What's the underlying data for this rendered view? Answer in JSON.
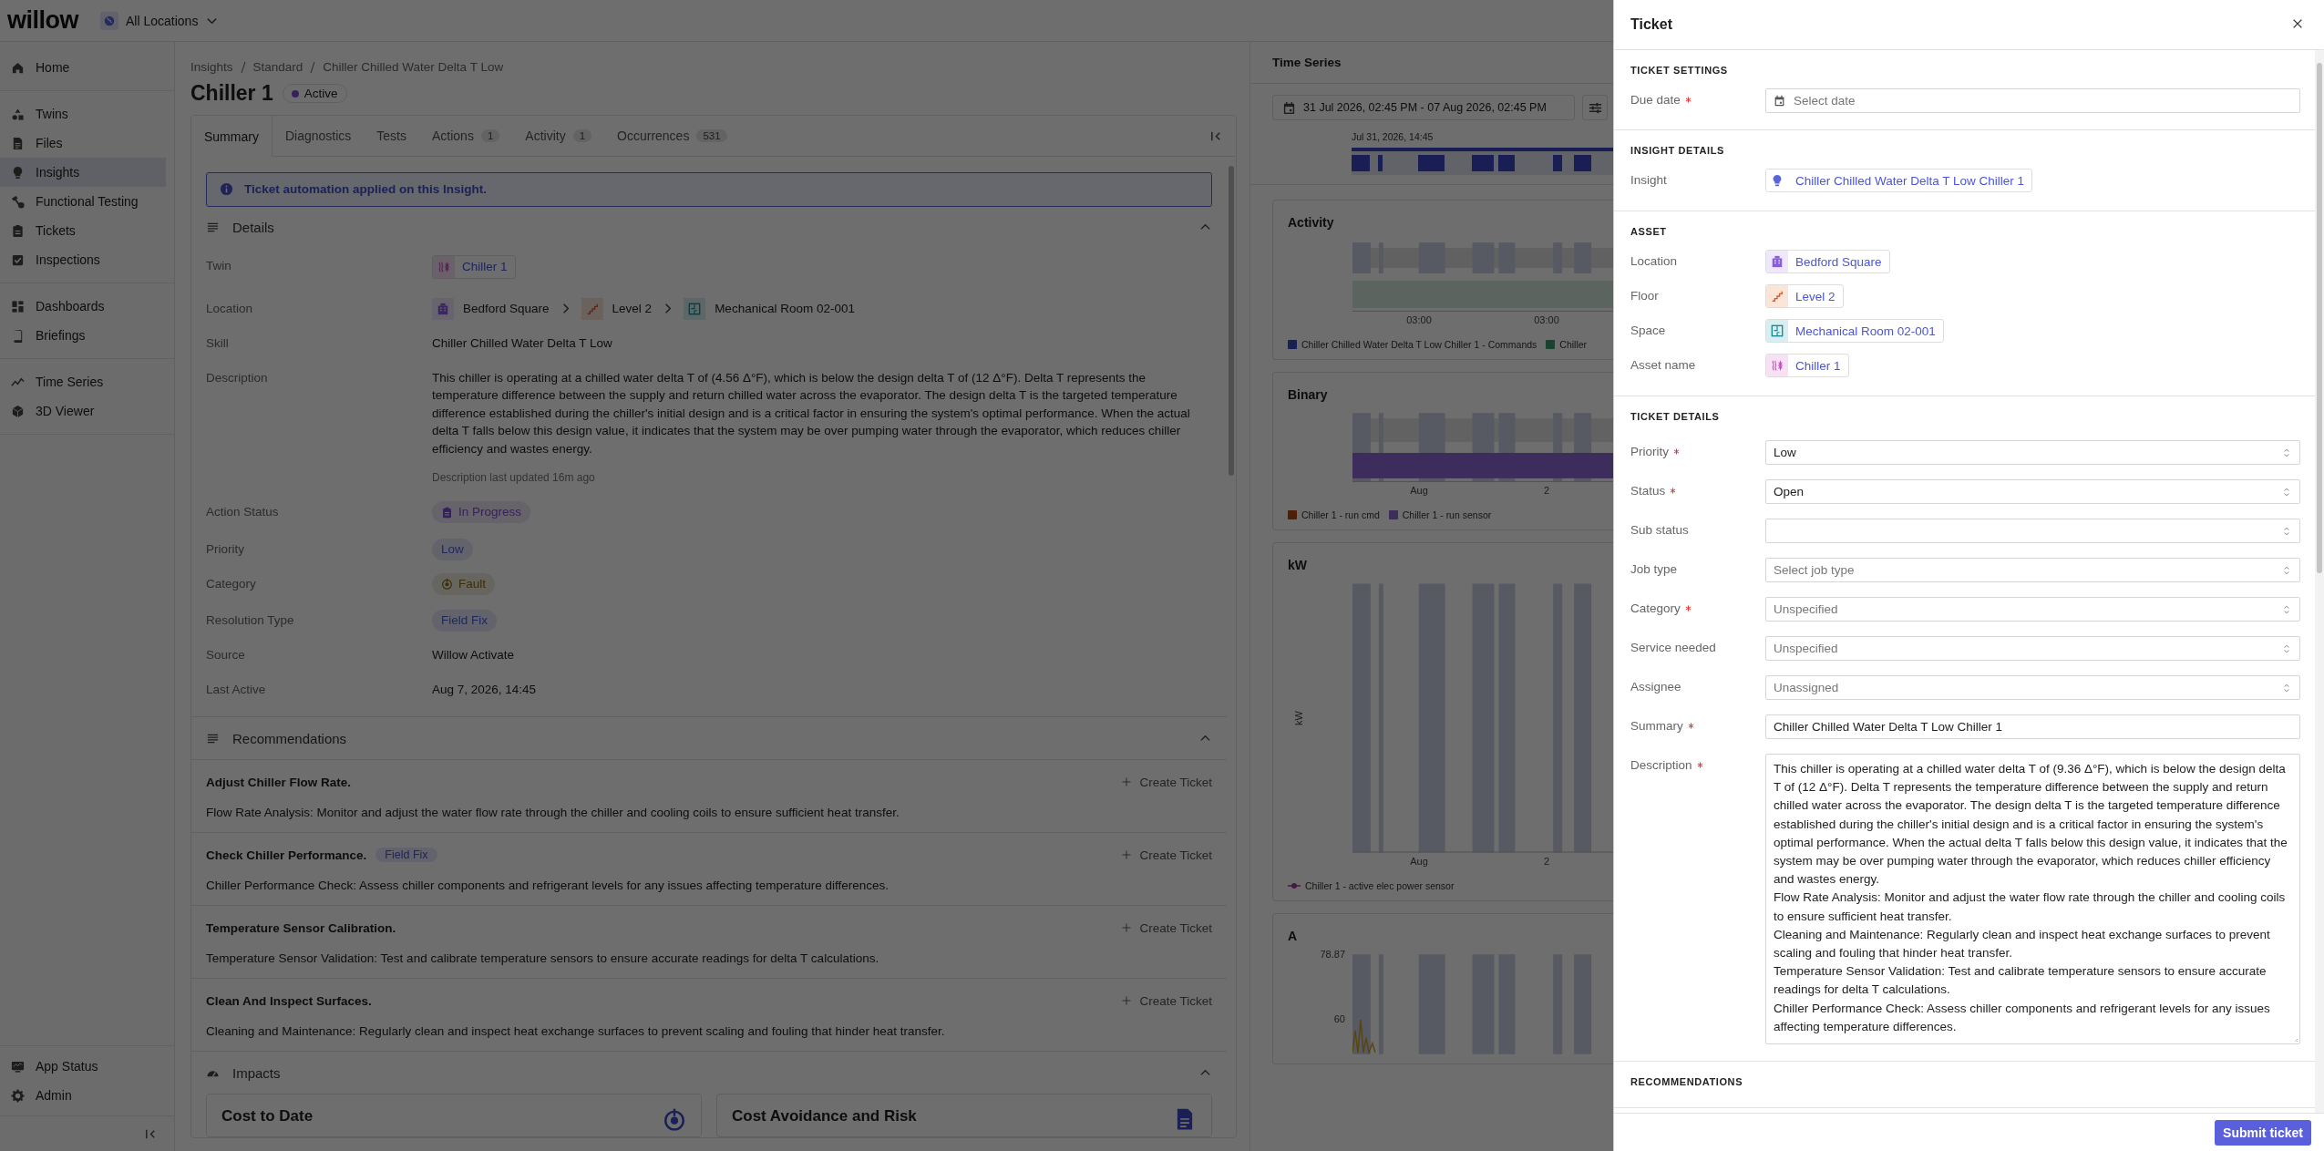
{
  "topbar": {
    "logo": "willow",
    "location": "All Locations"
  },
  "sidebar": {
    "groups": [
      {
        "items": [
          {
            "label": "Home",
            "selected": false
          }
        ]
      },
      {
        "items": [
          {
            "label": "Twins",
            "selected": false
          },
          {
            "label": "Files",
            "selected": false
          },
          {
            "label": "Insights",
            "selected": true
          },
          {
            "label": "Functional Testing",
            "selected": false
          },
          {
            "label": "Tickets",
            "selected": false
          },
          {
            "label": "Inspections",
            "selected": false
          }
        ]
      },
      {
        "items": [
          {
            "label": "Dashboards",
            "selected": false
          },
          {
            "label": "Briefings",
            "selected": false
          }
        ]
      },
      {
        "items": [
          {
            "label": "Time Series",
            "selected": false
          },
          {
            "label": "3D Viewer",
            "selected": false
          }
        ]
      }
    ],
    "footer_items": [
      {
        "label": "App Status",
        "selected": false
      },
      {
        "label": "Admin",
        "selected": false
      }
    ]
  },
  "insight": {
    "breadcrumb": [
      "Insights",
      "Standard",
      "Chiller Chilled Water Delta T Low"
    ],
    "title": "Chiller 1",
    "status": "Active",
    "tabs": [
      {
        "label": "Summary",
        "selected": true
      },
      {
        "label": "Diagnostics",
        "selected": false
      },
      {
        "label": "Tests",
        "selected": false
      },
      {
        "label": "Actions",
        "count": "1",
        "selected": false
      },
      {
        "label": "Activity",
        "count": "1",
        "selected": false
      },
      {
        "label": "Occurrences",
        "count": "531",
        "selected": false
      }
    ],
    "banner": "Ticket automation applied on this Insight.",
    "details": {
      "title": "Details",
      "rows": [
        {
          "label": "Twin",
          "kind": "chip",
          "value": "Chiller 1"
        },
        {
          "label": "Location",
          "kind": "path",
          "parts": [
            "Bedford Square",
            "Level 2",
            "Mechanical Room 02-001"
          ]
        },
        {
          "label": "Skill",
          "kind": "text",
          "value": "Chiller Chilled Water Delta T Low"
        },
        {
          "label": "Description",
          "kind": "description",
          "value": "This chiller is operating at a chilled water delta T of (4.56 Δ°F), which is below the design delta T of (12 Δ°F). Delta T represents the temperature difference between the supply and return chilled water across the evaporator. The design delta T is the targeted temperature difference established during the chiller's initial design and is a critical factor in ensuring the system's optimal performance. When the actual delta T falls below this design value, it indicates that the system may be over pumping water through the evaporator, which reduces chiller efficiency and wastes energy.",
          "note": "Description last updated 16m ago"
        },
        {
          "label": "Action Status",
          "kind": "pill",
          "value": "In Progress"
        },
        {
          "label": "Priority",
          "kind": "pill",
          "value": "Low"
        },
        {
          "label": "Category",
          "kind": "pill",
          "value": "Fault"
        },
        {
          "label": "Resolution Type",
          "kind": "pill",
          "value": "Field Fix"
        },
        {
          "label": "Source",
          "kind": "text",
          "value": "Willow Activate"
        },
        {
          "label": "Last Active",
          "kind": "text",
          "value": "Aug 7, 2026, 14:45"
        }
      ]
    },
    "recommendations": {
      "title": "Recommendations",
      "items": [
        {
          "title": "Adjust Chiller Flow Rate.",
          "text": "Flow Rate Analysis: Monitor and adjust the water flow rate through the chiller and cooling coils to ensure sufficient heat transfer.",
          "action": "Create Ticket"
        },
        {
          "title": "Check Chiller Performance.",
          "tag": "Field Fix",
          "text": "Chiller Performance Check: Assess chiller components and refrigerant levels for any issues affecting temperature differences.",
          "action": "Create Ticket"
        },
        {
          "title": "Temperature Sensor Calibration.",
          "text": "Temperature Sensor Validation: Test and calibrate temperature sensors to ensure accurate readings for delta T calculations.",
          "action": "Create Ticket"
        },
        {
          "title": "Clean And Inspect Surfaces.",
          "text": "Cleaning and Maintenance: Regularly clean and inspect heat exchange surfaces to prevent scaling and fouling that hinder heat transfer.",
          "action": "Create Ticket"
        }
      ]
    },
    "impacts": {
      "title": "Impacts",
      "cards": [
        {
          "title": "Cost to Date"
        },
        {
          "title": "Cost Avoidance and Risk"
        }
      ]
    }
  },
  "time_series": {
    "title": "Time Series",
    "range": "31 Jul 2026, 02:45 PM - 07 Aug 2026, 02:45 PM",
    "timeline_label": "Jul 31, 2026, 14:45",
    "charts": [
      {
        "title": "Activity",
        "kind": "activity",
        "xticks": [
          "03:00",
          "03:00"
        ],
        "legend": [
          {
            "label": "Chiller Chilled Water Delta T Low Chiller 1 - Commands"
          },
          {
            "label": "Chiller"
          }
        ]
      },
      {
        "title": "Binary",
        "kind": "binary",
        "xticks": [
          "Aug",
          "2"
        ],
        "legend": [
          {
            "label": "Chiller 1 - run cmd"
          },
          {
            "label": "Chiller 1 - run sensor"
          }
        ]
      },
      {
        "title": "kW",
        "kind": "line",
        "ylabel": "kW",
        "xticks": [
          "Aug",
          "2"
        ],
        "legend": [
          {
            "label": "Chiller 1 - active elec power sensor"
          }
        ]
      },
      {
        "title": "A",
        "kind": "spikes",
        "yticks": [
          "78.87",
          "60"
        ]
      }
    ]
  },
  "ticket": {
    "title": "Ticket",
    "sections": [
      {
        "heading": "TICKET SETTINGS",
        "fields": [
          {
            "label": "Due date",
            "required": true,
            "kind": "date",
            "placeholder": "Select date"
          }
        ]
      },
      {
        "heading": "INSIGHT DETAILS",
        "fields": [
          {
            "label": "Insight",
            "required": false,
            "kind": "link",
            "value": "Chiller Chilled Water Delta T Low Chiller 1"
          }
        ]
      },
      {
        "heading": "ASSET",
        "fields": [
          {
            "label": "Location",
            "required": false,
            "kind": "link",
            "value": "Bedford Square"
          },
          {
            "label": "Floor",
            "required": false,
            "kind": "link",
            "value": "Level 2"
          },
          {
            "label": "Space",
            "required": false,
            "kind": "link",
            "value": "Mechanical Room 02-001"
          },
          {
            "label": "Asset name",
            "required": false,
            "kind": "link",
            "value": "Chiller 1"
          }
        ]
      },
      {
        "heading": "TICKET DETAILS",
        "fields": [
          {
            "label": "Priority",
            "required": true,
            "kind": "select",
            "value": "Low"
          },
          {
            "label": "Status",
            "required": true,
            "kind": "select",
            "value": "Open"
          },
          {
            "label": "Sub status",
            "required": false,
            "kind": "select"
          },
          {
            "label": "Job type",
            "required": false,
            "kind": "select",
            "placeholder": "Select job type"
          },
          {
            "label": "Category",
            "required": true,
            "kind": "select",
            "placeholder": "Unspecified"
          },
          {
            "label": "Service needed",
            "required": false,
            "kind": "select",
            "placeholder": "Unspecified"
          },
          {
            "label": "Assignee",
            "required": false,
            "kind": "select",
            "placeholder": "Unassigned"
          },
          {
            "label": "Summary",
            "required": true,
            "kind": "text",
            "value": "Chiller Chilled Water Delta T Low Chiller 1"
          },
          {
            "label": "Description",
            "required": true,
            "kind": "textarea",
            "value": "This chiller is operating at a chilled water delta T of (9.36 Δ°F), which is below the design delta T of (12 Δ°F). Delta T represents the temperature difference between the supply and return chilled water across the evaporator. The design delta T is the targeted temperature difference established during the chiller's initial design and is a critical factor in ensuring the system's optimal performance. When the actual delta T falls below this design value, it indicates that the system may be over pumping water through the evaporator, which reduces chiller efficiency and wastes energy.\nFlow Rate Analysis: Monitor and adjust the water flow rate through the chiller and cooling coils to ensure sufficient heat transfer.\nCleaning and Maintenance: Regularly clean and inspect heat exchange surfaces to prevent scaling and fouling that hinder heat transfer.\nTemperature Sensor Validation: Test and calibrate temperature sensors to ensure accurate readings for delta T calculations.\nChiller Performance Check: Assess chiller components and refrigerant levels for any issues affecting temperature differences."
          }
        ]
      },
      {
        "heading": "RECOMMENDATIONS"
      }
    ],
    "submit": "Submit ticket"
  }
}
